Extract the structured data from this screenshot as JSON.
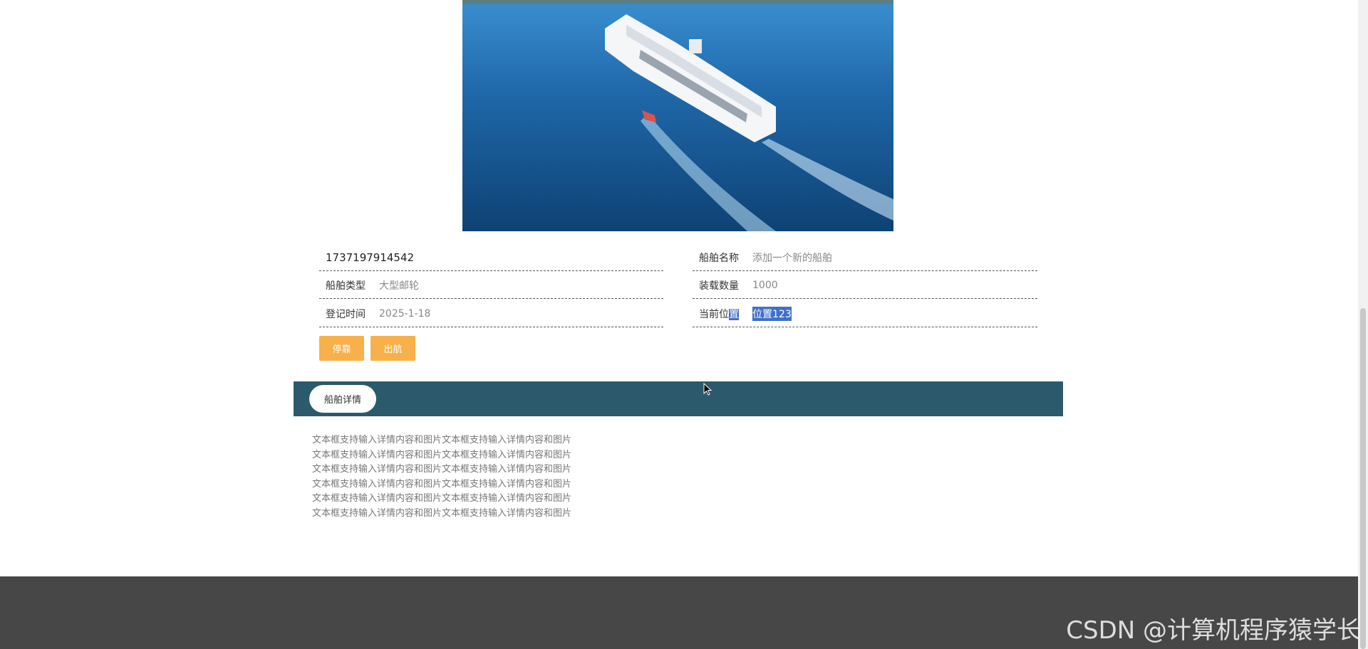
{
  "hero": {
    "image_icon": "cruise-ship-photo"
  },
  "info": {
    "id": "1737197914542",
    "ship_name": {
      "label": "船舶名称",
      "value": "添加一个新的船舶"
    },
    "ship_type": {
      "label": "船舶类型",
      "value": "大型邮轮"
    },
    "capacity": {
      "label": "装载数量",
      "value": "1000"
    },
    "register_time": {
      "label": "登记时间",
      "value": "2025-1-18"
    },
    "position": {
      "label_plain": "当前位",
      "label_selected": "置",
      "value": "位置123"
    }
  },
  "buttons": {
    "dock": "停靠",
    "sail": "出航"
  },
  "tabs": {
    "detail": "船舶详情"
  },
  "detail": {
    "lines": [
      "文本框支持输入详情内容和图片文本框支持输入详情内容和图片",
      "文本框支持输入详情内容和图片文本框支持输入详情内容和图片",
      "文本框支持输入详情内容和图片文本框支持输入详情内容和图片",
      "文本框支持输入详情内容和图片文本框支持输入详情内容和图片",
      "文本框支持输入详情内容和图片文本框支持输入详情内容和图片",
      "文本框支持输入详情内容和图片文本框支持输入详情内容和图片"
    ]
  },
  "watermark": "CSDN @计算机程序猿学长",
  "colors": {
    "button": "#f8b04a",
    "tabbar": "#2a5a6c",
    "footer": "#474747",
    "selection": "#3f6fc9"
  }
}
